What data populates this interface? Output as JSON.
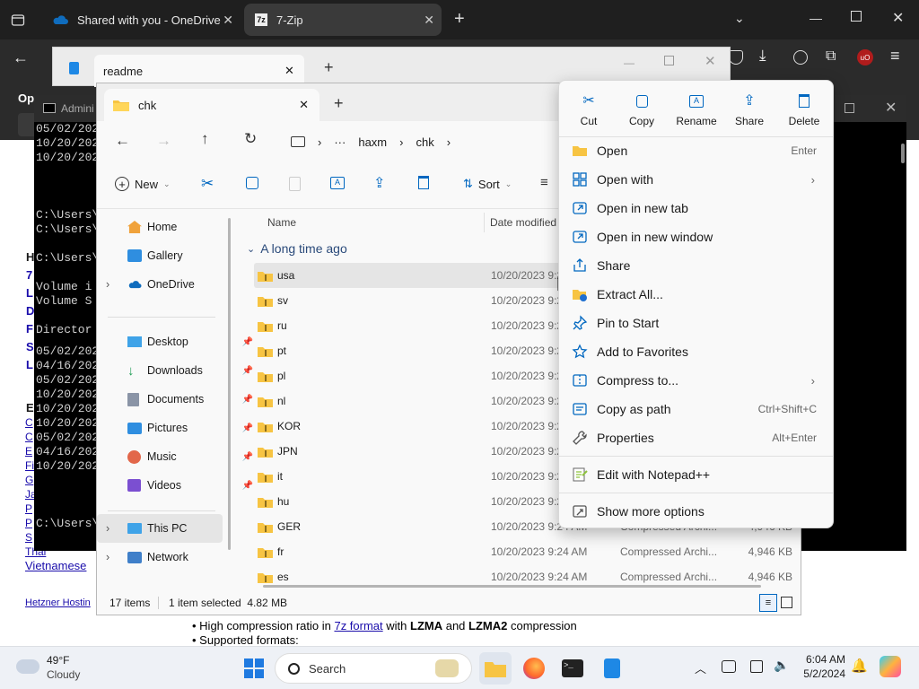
{
  "browser": {
    "tabs": [
      {
        "label": "Shared with you - OneDrive",
        "icon": "onedrive-icon"
      },
      {
        "label": "7-Zip",
        "icon": "7zip-icon"
      }
    ]
  },
  "notepad": {
    "tab_label": "readme"
  },
  "cmd": {
    "title": "Admini",
    "lines_top": [
      "05/02/202",
      "10/20/202",
      "10/20/202"
    ],
    "lines_mid": [
      "C:\\Users\\",
      "C:\\Users\\",
      "C:\\Users\\"
    ],
    "volume_lines": [
      " Volume i",
      " Volume S",
      " Director"
    ],
    "date_lines": [
      "05/02/202",
      "04/16/202",
      "05/02/202",
      "10/20/202",
      "10/20/202",
      "10/20/202",
      "05/02/202",
      "04/16/202",
      "10/20/202"
    ],
    "prompt_bottom": "C:\\Users\\"
  },
  "webpage": {
    "left_letters": [
      "H",
      "7",
      "L",
      "D",
      "F",
      "S",
      "L",
      "E"
    ],
    "link_letters": [
      "C",
      "C",
      "E",
      "Fi",
      "G",
      "Ja",
      "P",
      "P",
      "S"
    ],
    "thai": "Thai",
    "vietnamese": "Vietnamese",
    "hetzner": "Hetzner Hostin",
    "bullet1_pre": "High compression ratio in ",
    "bullet1_link": "7z format",
    "bullet1_mid": " with ",
    "bullet1_b1": "LZMA",
    "bullet1_and": " and ",
    "bullet1_b2": "LZMA2",
    "bullet1_post": " compression",
    "bullet2": "Supported formats:"
  },
  "explorer": {
    "tab_label": "chk",
    "breadcrumb": [
      "haxm",
      "chk"
    ],
    "toolbar": {
      "new_label": "New",
      "sort_label": "Sort"
    },
    "nav_items": [
      {
        "label": "Home",
        "icon": "home-icon"
      },
      {
        "label": "Gallery",
        "icon": "gallery-icon"
      },
      {
        "label": "OneDrive",
        "icon": "onedrive-icon"
      },
      {
        "label": "Desktop",
        "icon": "desktop-icon"
      },
      {
        "label": "Downloads",
        "icon": "downloads-icon"
      },
      {
        "label": "Documents",
        "icon": "documents-icon"
      },
      {
        "label": "Pictures",
        "icon": "pictures-icon"
      },
      {
        "label": "Music",
        "icon": "music-icon"
      },
      {
        "label": "Videos",
        "icon": "videos-icon"
      },
      {
        "label": "This PC",
        "icon": "pc-icon"
      },
      {
        "label": "Network",
        "icon": "network-icon"
      }
    ],
    "columns": {
      "name": "Name",
      "date": "Date modified"
    },
    "group_label": "A long time ago",
    "files": [
      {
        "name": "usa",
        "date": "10/20/2023 9:2",
        "type": "",
        "size": ""
      },
      {
        "name": "sv",
        "date": "10/20/2023 9:2",
        "type": "",
        "size": ""
      },
      {
        "name": "ru",
        "date": "10/20/2023 9:2",
        "type": "",
        "size": ""
      },
      {
        "name": "pt",
        "date": "10/20/2023 9:2",
        "type": "",
        "size": ""
      },
      {
        "name": "pl",
        "date": "10/20/2023 9:2",
        "type": "",
        "size": ""
      },
      {
        "name": "nl",
        "date": "10/20/2023 9:2",
        "type": "",
        "size": ""
      },
      {
        "name": "KOR",
        "date": "10/20/2023 9:2",
        "type": "",
        "size": ""
      },
      {
        "name": "JPN",
        "date": "10/20/2023 9:2",
        "type": "",
        "size": ""
      },
      {
        "name": "it",
        "date": "10/20/2023 9:2",
        "type": "",
        "size": ""
      },
      {
        "name": "hu",
        "date": "10/20/2023 9:2",
        "type": "",
        "size": ""
      },
      {
        "name": "GER",
        "date": "10/20/2023 9:24 AM",
        "type": "Compressed Archi...",
        "size": "4,946 KB"
      },
      {
        "name": "fr",
        "date": "10/20/2023 9:24 AM",
        "type": "Compressed Archi...",
        "size": "4,946 KB"
      },
      {
        "name": "es",
        "date": "10/20/2023 9:24 AM",
        "type": "Compressed Archi...",
        "size": "4,946 KB"
      }
    ],
    "status": {
      "count": "17 items",
      "selected": "1 item selected  4.82 MB"
    }
  },
  "context_menu": {
    "top_actions": [
      {
        "label": "Cut",
        "icon": "cut-icon"
      },
      {
        "label": "Copy",
        "icon": "copy-icon"
      },
      {
        "label": "Rename",
        "icon": "rename-icon"
      },
      {
        "label": "Share",
        "icon": "share-icon"
      },
      {
        "label": "Delete",
        "icon": "delete-icon"
      }
    ],
    "items": [
      {
        "label": "Open",
        "shortcut": "Enter",
        "icon": "open-folder-icon"
      },
      {
        "label": "Open with",
        "submenu": true,
        "icon": "open-with-icon"
      },
      {
        "label": "Open in new tab",
        "icon": "new-tab-icon"
      },
      {
        "label": "Open in new window",
        "icon": "new-window-icon"
      },
      {
        "label": "Share",
        "icon": "share-icon"
      },
      {
        "label": "Extract All...",
        "icon": "extract-icon"
      },
      {
        "label": "Pin to Start",
        "icon": "pin-icon"
      },
      {
        "label": "Add to Favorites",
        "icon": "star-icon"
      },
      {
        "label": "Compress to...",
        "submenu": true,
        "icon": "compress-icon"
      },
      {
        "label": "Copy as path",
        "shortcut": "Ctrl+Shift+C",
        "icon": "copy-path-icon"
      },
      {
        "label": "Properties",
        "shortcut": "Alt+Enter",
        "icon": "wrench-icon"
      },
      {
        "label": "Edit with Notepad++",
        "icon": "notepadpp-icon"
      },
      {
        "label": "Show more options",
        "icon": "more-options-icon"
      }
    ]
  },
  "taskbar": {
    "weather_temp": "49°F",
    "weather_desc": "Cloudy",
    "search_label": "Search",
    "time": "6:04 AM",
    "date": "5/2/2024"
  },
  "colors": {
    "accent": "#0067c0",
    "folder": "#f7c443",
    "selection": "#e5e5e5"
  }
}
